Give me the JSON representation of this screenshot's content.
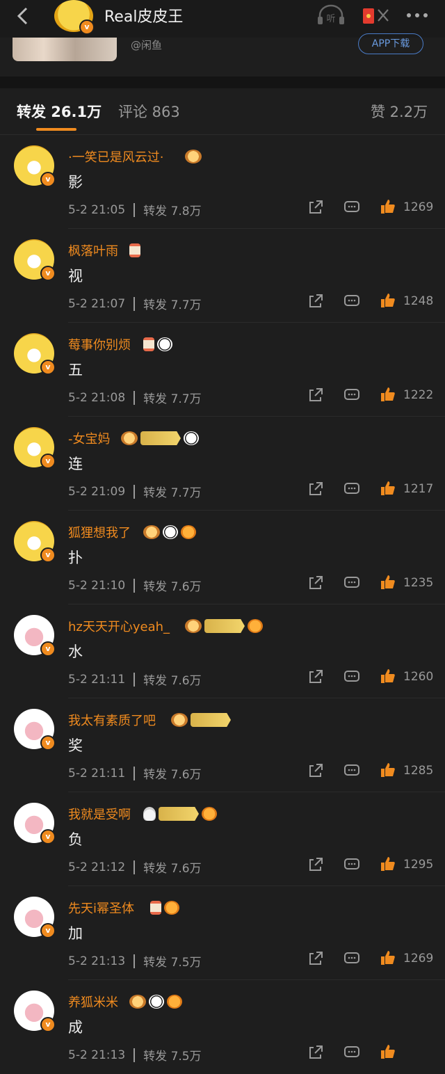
{
  "header": {
    "title": "Real皮皮王",
    "listen_label": "听",
    "source_text": "@闲鱼",
    "app_download": "APP下载",
    "accent": "#f08b1f"
  },
  "tabs": {
    "repost": "转发 26.1万",
    "comment": "评论 863",
    "like": "赞 2.2万"
  },
  "comments": [
    {
      "name": "·一笑已是风云过·",
      "text": "影",
      "time": "5-2 21:05",
      "repost": "转发 7.8万",
      "likes": "1269"
    },
    {
      "name": "枫落叶雨",
      "text": "视",
      "time": "5-2 21:07",
      "repost": "转发 7.7万",
      "likes": "1248"
    },
    {
      "name": "莓事你别烦",
      "text": "五",
      "time": "5-2 21:08",
      "repost": "转发 7.7万",
      "likes": "1222"
    },
    {
      "name": "-女宝妈",
      "text": "连",
      "time": "5-2 21:09",
      "repost": "转发 7.7万",
      "likes": "1217"
    },
    {
      "name": "狐狸想我了",
      "text": "扑",
      "time": "5-2 21:10",
      "repost": "转发 7.6万",
      "likes": "1235"
    },
    {
      "name": "hz天天开心yeah_",
      "text": "水",
      "time": "5-2 21:11",
      "repost": "转发 7.6万",
      "likes": "1260"
    },
    {
      "name": "我太有素质了吧",
      "text": "奖",
      "time": "5-2 21:11",
      "repost": "转发 7.6万",
      "likes": "1285"
    },
    {
      "name": "我就是受啊",
      "text": "负",
      "time": "5-2 21:12",
      "repost": "转发 7.6万",
      "likes": "1295"
    },
    {
      "name": "先天i幂圣体",
      "text": "加",
      "time": "5-2 21:13",
      "repost": "转发 7.5万",
      "likes": "1269"
    },
    {
      "name": "养狐米米",
      "text": "成",
      "time": "5-2 21:13",
      "repost": "转发 7.5万",
      "likes": ""
    }
  ]
}
